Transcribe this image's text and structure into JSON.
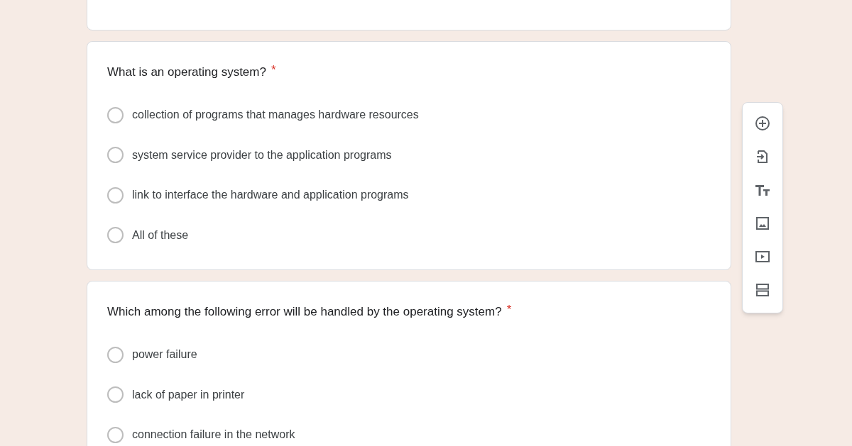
{
  "questions": [
    {
      "text": "What is an operating system?",
      "required_mark": "*",
      "options": [
        {
          "label": "collection of programs that manages hardware resources",
          "selected": false
        },
        {
          "label": "system service provider to the application programs",
          "selected": false
        },
        {
          "label": "link to interface the hardware and application programs",
          "selected": false
        },
        {
          "label": "All of these",
          "selected": false
        }
      ]
    },
    {
      "text": "Which among the following error will be handled by the operating system?",
      "required_mark": "*",
      "options": [
        {
          "label": "power failure",
          "selected": false
        },
        {
          "label": "lack of paper in printer",
          "selected": false
        },
        {
          "label": "connection failure in the network",
          "selected": false
        }
      ]
    }
  ],
  "toolbar": [
    {
      "kind": "add"
    },
    {
      "kind": "import"
    },
    {
      "kind": "title"
    },
    {
      "kind": "image"
    },
    {
      "kind": "video"
    },
    {
      "kind": "section"
    }
  ]
}
